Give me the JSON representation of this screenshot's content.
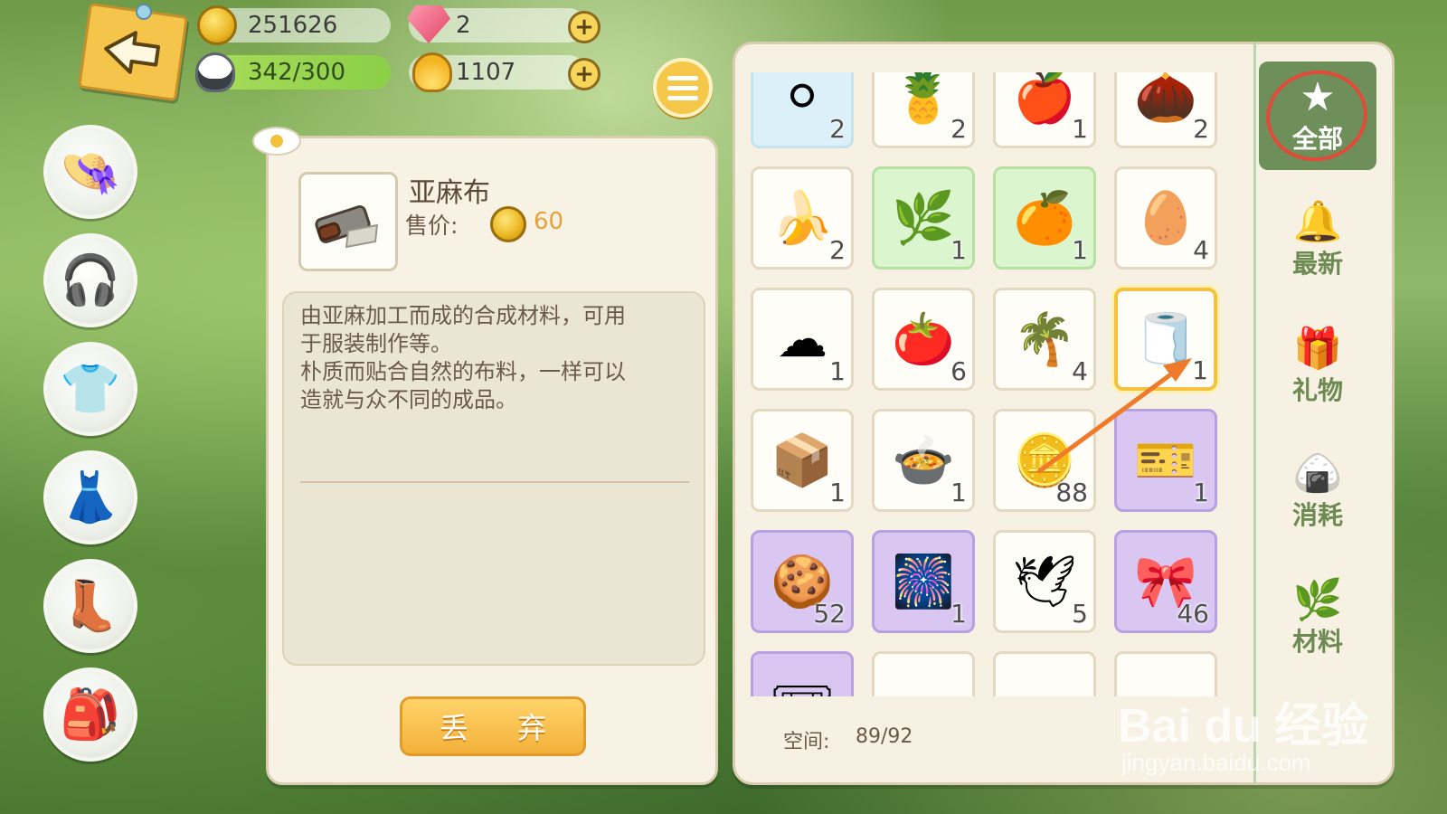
{
  "currency": {
    "coins": "251626",
    "gems": "2",
    "stamina": "342/300",
    "shells": "1107"
  },
  "side_buttons": [
    "hat-icon",
    "headphones-icon",
    "shirt-icon",
    "skirt-icon",
    "shoes-icon",
    "backpack-icon"
  ],
  "detail": {
    "name": "亚麻布",
    "price_label": "售价:",
    "price": "60",
    "description_lines": [
      "由亚麻加工而成的合成材料，可用",
      "于服装制作等。",
      "朴质而贴合自然的布料，一样可以",
      "造就与众不同的成品。"
    ],
    "discard_label": "丢 弃"
  },
  "inventory": {
    "space_label": "空间:",
    "space_value": "89/92",
    "items": [
      {
        "icon": "pearl-icon",
        "qty": "2",
        "bg": "blue"
      },
      {
        "icon": "pineapple-icon",
        "qty": "2",
        "bg": "white"
      },
      {
        "icon": "apple-icon",
        "qty": "1",
        "bg": "white"
      },
      {
        "icon": "chestnut-icon",
        "qty": "2",
        "bg": "white"
      },
      {
        "icon": "banana-icon",
        "qty": "2",
        "bg": "white"
      },
      {
        "icon": "herb-icon",
        "qty": "1",
        "bg": "green"
      },
      {
        "icon": "physalis-icon",
        "qty": "1",
        "bg": "green"
      },
      {
        "icon": "egg-icon",
        "qty": "4",
        "bg": "white"
      },
      {
        "icon": "cotton-icon",
        "qty": "1",
        "bg": "white"
      },
      {
        "icon": "tomato-icon",
        "qty": "6",
        "bg": "white"
      },
      {
        "icon": "palm-log-icon",
        "qty": "4",
        "bg": "white"
      },
      {
        "icon": "linen-cloth-icon",
        "qty": "1",
        "bg": "white",
        "selected": true
      },
      {
        "icon": "wooden-crate-icon",
        "qty": "1",
        "bg": "white"
      },
      {
        "icon": "cooking-pot-icon",
        "qty": "1",
        "bg": "white"
      },
      {
        "icon": "gold-coin-icon",
        "qty": "88",
        "bg": "white"
      },
      {
        "icon": "ticket-icon",
        "qty": "1",
        "bg": "purple"
      },
      {
        "icon": "badge-icon",
        "qty": "52",
        "bg": "purple"
      },
      {
        "icon": "fireworks-box-icon",
        "qty": "1",
        "bg": "purple"
      },
      {
        "icon": "emblem-icon",
        "qty": "5",
        "bg": "white"
      },
      {
        "icon": "photo-emblem-icon",
        "qty": "46",
        "bg": "purple"
      },
      {
        "icon": "coupon-icon",
        "qty": "",
        "bg": "purple"
      },
      {
        "icon": "empty-slot",
        "qty": "",
        "bg": "white"
      },
      {
        "icon": "empty-slot",
        "qty": "",
        "bg": "white"
      },
      {
        "icon": "empty-slot",
        "qty": "",
        "bg": "white"
      }
    ]
  },
  "tabs": [
    {
      "label": "全部",
      "icon": "star-icon",
      "active": true
    },
    {
      "label": "最新",
      "icon": "bell-icon"
    },
    {
      "label": "礼物",
      "icon": "gift-icon"
    },
    {
      "label": "消耗",
      "icon": "riceball-icon"
    },
    {
      "label": "材料",
      "icon": "branch-icon"
    }
  ],
  "watermark": {
    "brand": "Bai du 经验",
    "url": "jingyan.baidu.com"
  },
  "colors": {
    "accent": "#f4c23e",
    "tab_active": "#6e8f5a",
    "arrow": "#f07a2a"
  }
}
